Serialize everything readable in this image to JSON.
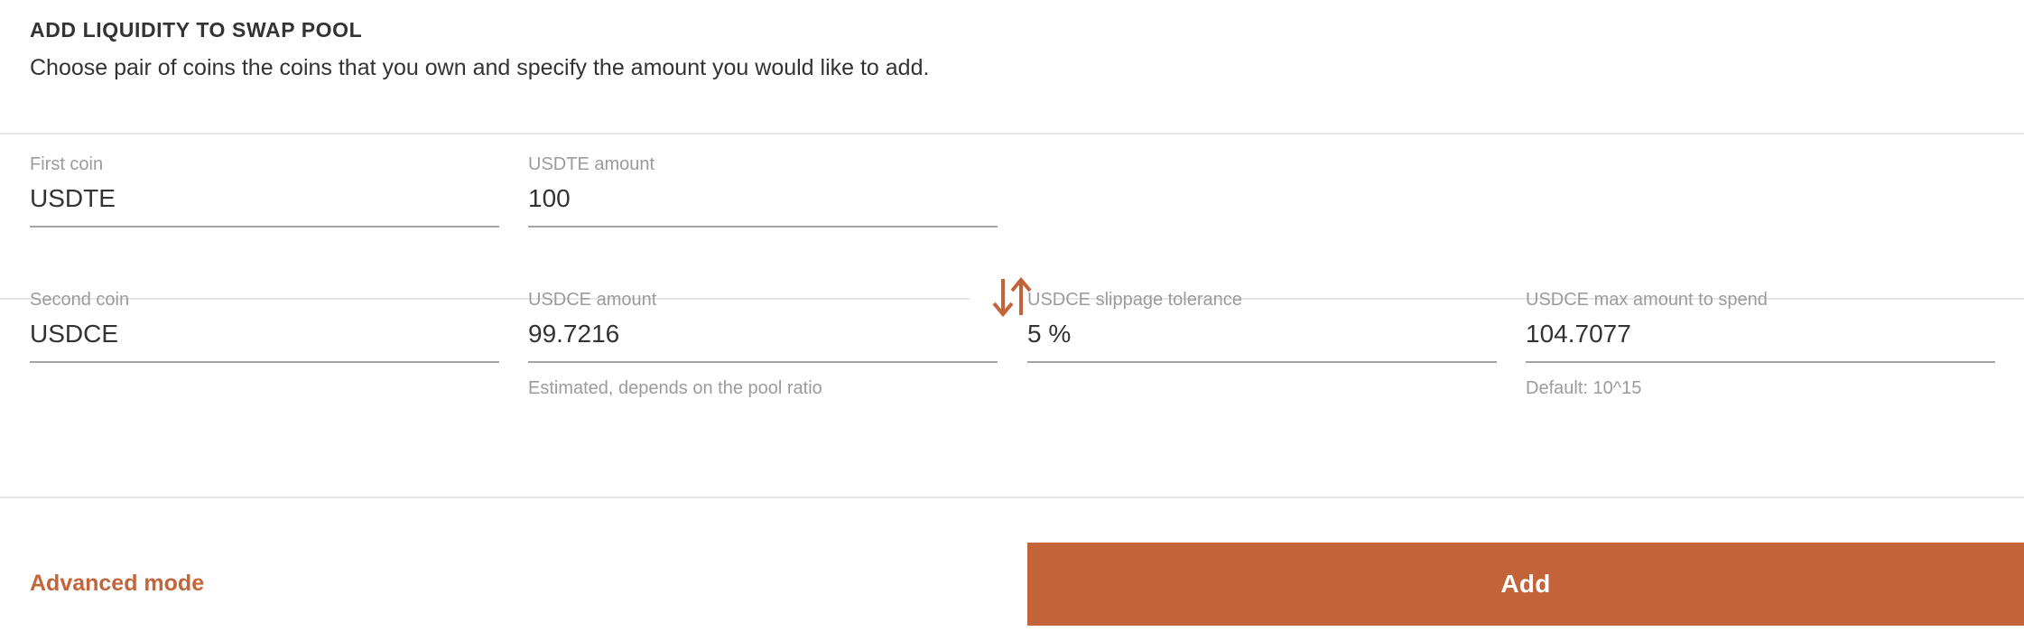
{
  "header": {
    "title": "ADD LIQUIDITY TO SWAP POOL",
    "subtitle": "Choose pair of coins the coins that you own and specify the amount you would like to add."
  },
  "colors": {
    "accent": "#c2633a",
    "label": "#9b9b9b",
    "value": "#333333",
    "divider": "#e6e6e6",
    "underline": "#a3a3a3"
  },
  "swap_icon": {
    "name": "swap-arrows-icon",
    "color": "#c2633a"
  },
  "fields": {
    "first_coin": {
      "label": "First coin",
      "value": "USDTE",
      "helper": ""
    },
    "first_amount": {
      "label": "USDTE amount",
      "value": "100",
      "helper": ""
    },
    "second_coin": {
      "label": "Second coin",
      "value": "USDCE",
      "helper": ""
    },
    "second_amount": {
      "label": "USDCE amount",
      "value": "99.7216",
      "helper": "Estimated, depends on the pool ratio"
    },
    "slippage": {
      "label": "USDCE slippage tolerance",
      "value": "5 %",
      "helper": ""
    },
    "max_spend": {
      "label": "USDCE max amount to spend",
      "value": "104.7077",
      "helper": "Default: 10^15"
    }
  },
  "footer": {
    "advanced_mode_label": "Advanced mode",
    "add_button_label": "Add"
  }
}
